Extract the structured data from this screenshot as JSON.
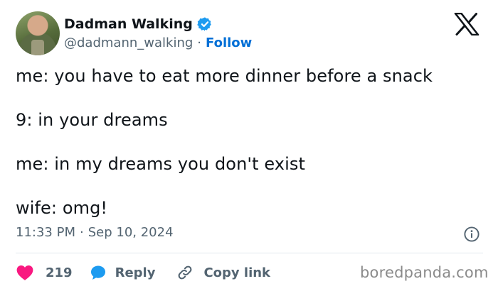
{
  "author": {
    "display_name": "Dadman Walking",
    "handle": "@dadmann_walking",
    "separator": "·",
    "follow_label": "Follow",
    "verified": true
  },
  "tweet": {
    "lines": [
      "me: you have to eat more dinner before a snack",
      "9: in your dreams",
      "me: in my dreams you don't exist",
      "wife: omg!"
    ],
    "time": "11:33 PM",
    "separator": "·",
    "date": "Sep 10, 2024"
  },
  "actions": {
    "like_count": "219",
    "reply_label": "Reply",
    "copy_label": "Copy link"
  },
  "watermark": "boredpanda.com",
  "icons": {
    "brand": "x-logo-icon",
    "verified": "verified-badge-icon",
    "info": "info-icon",
    "like": "heart-icon",
    "reply": "reply-bubble-icon",
    "copy": "link-icon"
  },
  "colors": {
    "text": "#0f1419",
    "secondary": "#536471",
    "follow": "#006fd6",
    "verified": "#1d9bf0",
    "heart": "#f91880",
    "reply": "#1d9bf0",
    "divider": "#e1e8ed"
  }
}
